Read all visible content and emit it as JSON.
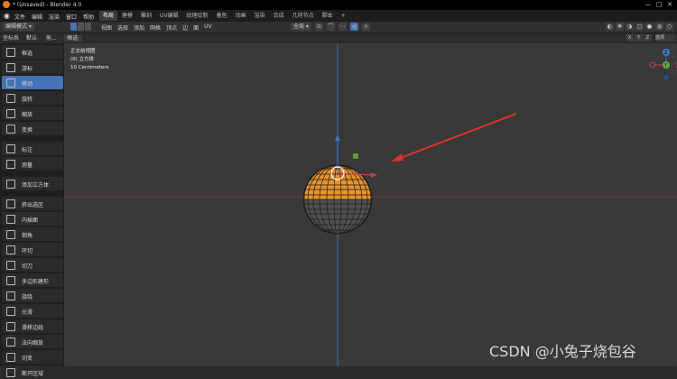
{
  "window": {
    "title": "* (Unsaved) - Blender 4.0",
    "controls": [
      "—",
      "□",
      "✕"
    ]
  },
  "menubar": {
    "menus": [
      "文件",
      "编辑",
      "渲染",
      "窗口",
      "帮助"
    ],
    "tabs": [
      {
        "label": "布局",
        "active": true
      },
      {
        "label": "建模",
        "active": false
      },
      {
        "label": "雕刻",
        "active": false
      },
      {
        "label": "UV编辑",
        "active": false
      },
      {
        "label": "纹理绘制",
        "active": false
      },
      {
        "label": "着色",
        "active": false
      },
      {
        "label": "动画",
        "active": false
      },
      {
        "label": "渲染",
        "active": false
      },
      {
        "label": "合成",
        "active": false
      },
      {
        "label": "几何节点",
        "active": false
      },
      {
        "label": "脚本",
        "active": false
      },
      {
        "label": "+",
        "active": false
      }
    ]
  },
  "toolbar": {
    "mode": "编辑模式",
    "view_menus": [
      "视图",
      "选择",
      "添加",
      "网格",
      "顶点",
      "边",
      "面",
      "UV"
    ],
    "transform_orientation": "全局",
    "right_label": ""
  },
  "header2": {
    "coord_label": "坐标系",
    "coord_value": "默认",
    "drag_label": "拖...",
    "drag_value": "框选",
    "xyz": [
      "X",
      "Y",
      "Z"
    ],
    "options": "选项"
  },
  "tools": [
    {
      "label": "框选",
      "icon": "select-box-icon",
      "active": false
    },
    {
      "label": "游标",
      "icon": "cursor-icon",
      "active": false
    },
    {
      "label": "移动",
      "icon": "move-icon",
      "active": true
    },
    {
      "label": "旋转",
      "icon": "rotate-icon",
      "active": false
    },
    {
      "label": "缩放",
      "icon": "scale-icon",
      "active": false
    },
    {
      "label": "变换",
      "icon": "transform-icon",
      "active": false
    },
    {
      "label": "标注",
      "icon": "annotate-icon",
      "active": false
    },
    {
      "label": "测量",
      "icon": "measure-icon",
      "active": false
    },
    {
      "label": "添加立方体",
      "icon": "add-cube-icon",
      "active": false
    },
    {
      "label": "挤出选区",
      "icon": "extrude-icon",
      "active": false
    },
    {
      "label": "内插面",
      "icon": "inset-icon",
      "active": false
    },
    {
      "label": "倒角",
      "icon": "bevel-icon",
      "active": false
    },
    {
      "label": "环切",
      "icon": "loop-cut-icon",
      "active": false
    },
    {
      "label": "切刀",
      "icon": "knife-icon",
      "active": false
    },
    {
      "label": "多边形建形",
      "icon": "poly-build-icon",
      "active": false
    },
    {
      "label": "旋绕",
      "icon": "spin-icon",
      "active": false
    },
    {
      "label": "光滑",
      "icon": "smooth-icon",
      "active": false
    },
    {
      "label": "滑移边线",
      "icon": "edge-slide-icon",
      "active": false
    },
    {
      "label": "法向缩放",
      "icon": "shrink-fatten-icon",
      "active": false
    },
    {
      "label": "切变",
      "icon": "shear-icon",
      "active": false
    },
    {
      "label": "断开区域",
      "icon": "rip-icon",
      "active": false
    }
  ],
  "viewport": {
    "view_name": "正交前视图",
    "object_info": "(0) 立方体",
    "scale_info": "10 Centimeters"
  },
  "gizmo": {
    "labels": [
      "Z",
      "Y",
      "X"
    ]
  },
  "colors": {
    "selected_face": "#e8932b",
    "axis_x": "#c2414a",
    "axis_z": "#3c78c6",
    "arrow": "#e03030",
    "active_tool": "#4772b3"
  },
  "watermark": "CSDN @小兔子烧包谷"
}
